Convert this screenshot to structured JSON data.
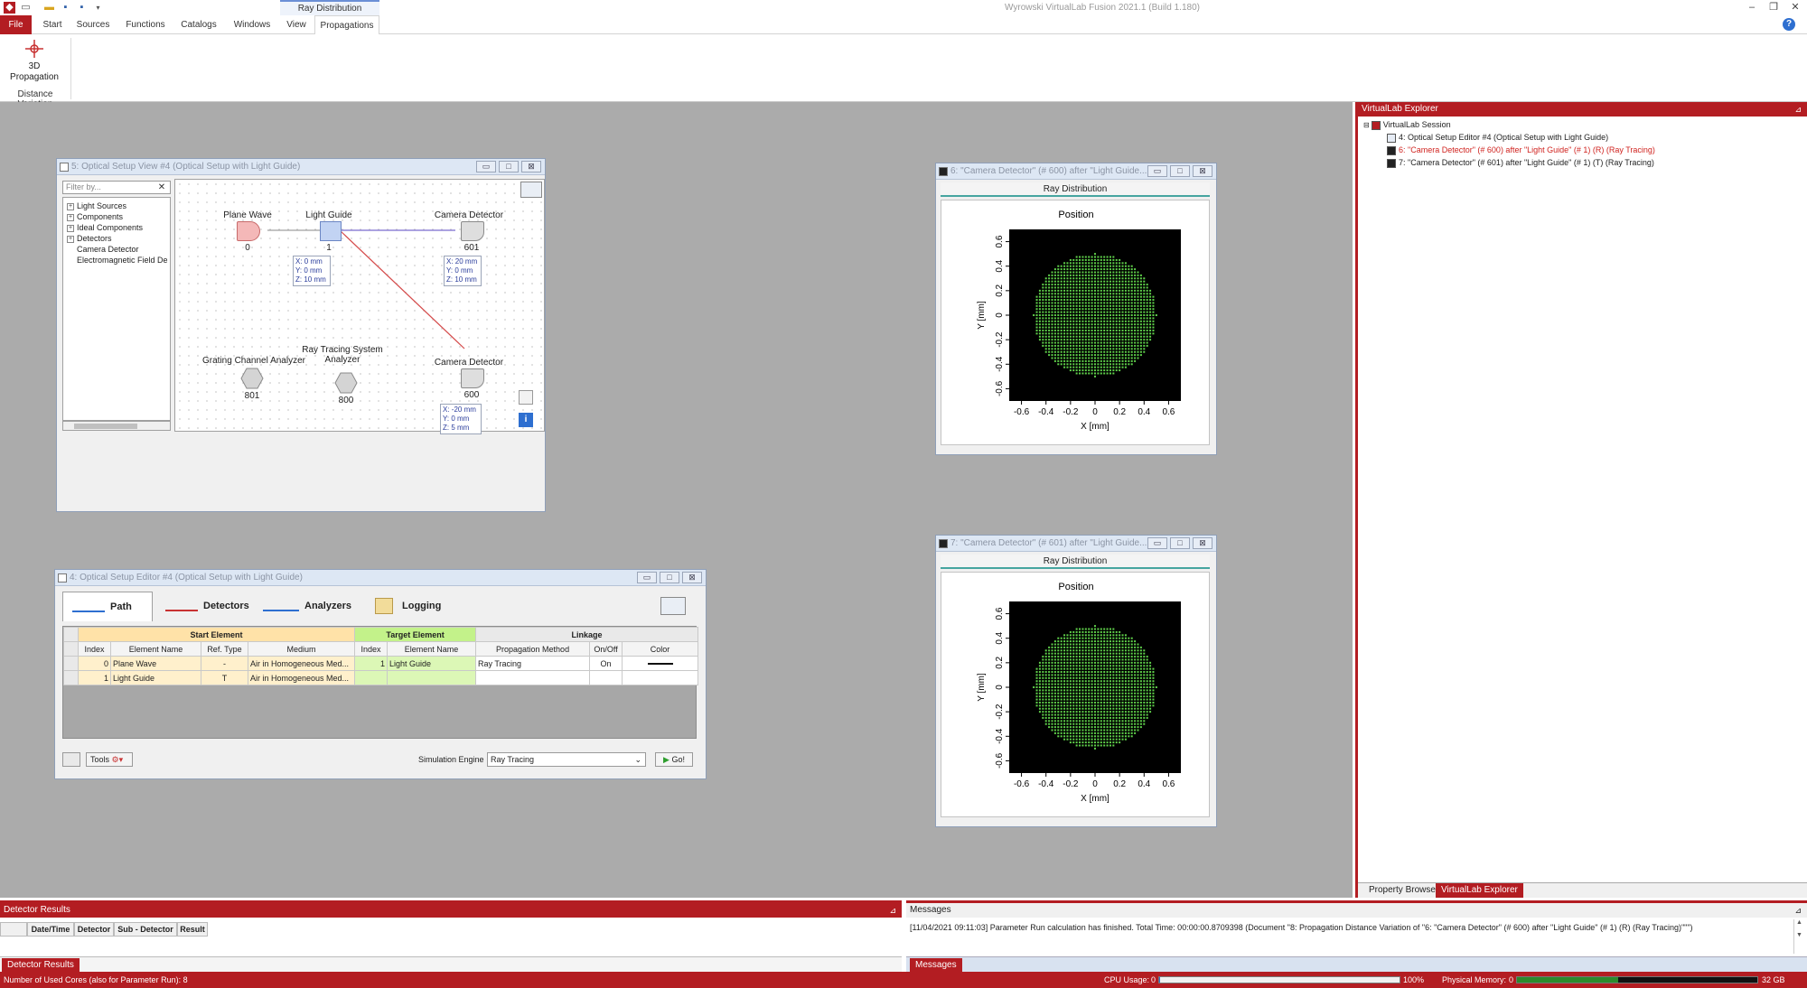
{
  "app": {
    "title": "Wyrowski VirtualLab Fusion 2021.1 (Build 1.180)",
    "context_tab": "Ray Distribution",
    "help_label": "?"
  },
  "ribbon": {
    "tabs": [
      "File",
      "Start",
      "Sources",
      "Functions",
      "Catalogs",
      "Windows",
      "View",
      "Propagations"
    ],
    "active_tab": "Propagations",
    "buttons": [
      {
        "label_line1": "3D",
        "label_line2": "Propagation"
      }
    ],
    "group_label": "Distance Variation"
  },
  "setup_view": {
    "title": "5: Optical Setup View #4 (Optical Setup with Light Guide)",
    "filter_placeholder": "Filter by...",
    "tree": [
      {
        "label": "Light Sources",
        "expandable": true
      },
      {
        "label": "Components",
        "expandable": true
      },
      {
        "label": "Ideal Components",
        "expandable": true
      },
      {
        "label": "Detectors",
        "expandable": true
      },
      {
        "label": "Camera Detector",
        "expandable": false
      },
      {
        "label": "Electromagnetic Field De",
        "expandable": false
      }
    ],
    "nodes": {
      "plane_wave": {
        "label": "Plane Wave",
        "index": "0"
      },
      "light_guide": {
        "label": "Light Guide",
        "index": "1",
        "coords": [
          "X: 0 mm",
          "Y: 0 mm",
          "Z: 10 mm"
        ]
      },
      "camera_601": {
        "label": "Camera Detector",
        "index": "601",
        "coords": [
          "X: 20 mm",
          "Y: 0 mm",
          "Z: 10 mm"
        ]
      },
      "grating": {
        "label": "Grating Channel Analyzer",
        "index": "801"
      },
      "ray_tracing": {
        "label_line1": "Ray Tracing System",
        "label_line2": "Analyzer",
        "index": "800"
      },
      "camera_600": {
        "label": "Camera Detector",
        "index": "600",
        "coords": [
          "X: -20 mm",
          "Y: 0 mm",
          "Z: 5 mm"
        ]
      }
    }
  },
  "editor": {
    "title": "4: Optical Setup Editor #4 (Optical Setup with Light Guide)",
    "tabs": [
      "Path",
      "Detectors",
      "Analyzers",
      "Logging"
    ],
    "active_tab": "Path",
    "group_headers": {
      "start": "Start Element",
      "target": "Target Element",
      "linkage": "Linkage"
    },
    "columns": [
      "Index",
      "Element Name",
      "Ref. Type",
      "Medium",
      "Index",
      "Element Name",
      "Propagation Method",
      "On/Off",
      "Color"
    ],
    "rows": [
      [
        "0",
        "Plane Wave",
        "-",
        "Air in Homogeneous Med...",
        "1",
        "Light Guide",
        "Ray Tracing",
        "On",
        "line"
      ],
      [
        "1",
        "Light Guide",
        "T",
        "Air in Homogeneous Med...",
        "",
        "",
        "",
        "",
        ""
      ]
    ],
    "tools_label": "Tools",
    "sim_engine_label": "Simulation Engine",
    "sim_engine_value": "Ray Tracing",
    "go_label": "Go!"
  },
  "ray_windows": [
    {
      "title": "6: \"Camera Detector\" (# 600) after \"Light Guide\" (# 1) (R) (Ray Tracing)",
      "title_visible": "6: \"Camera Detector\" (# 600) after \"Light Guide...",
      "tab": "Ray Distribution",
      "plot_title": "Position",
      "xlabel": "X [mm]",
      "ylabel": "Y [mm]"
    },
    {
      "title": "7: \"Camera Detector\" (# 601) after \"Light Guide\" (# 1) (T) (Ray Tracing)",
      "title_visible": "7: \"Camera Detector\" (# 601) after \"Light Guide...",
      "tab": "Ray Distribution",
      "plot_title": "Position",
      "xlabel": "X [mm]",
      "ylabel": "Y [mm]"
    }
  ],
  "plot_axis": {
    "ticks": [
      "-0.6",
      "-0.4",
      "-0.2",
      "0",
      "0.2",
      "0.4",
      "0.6"
    ],
    "range": [
      -0.7,
      0.7
    ],
    "spot_radius": 0.5,
    "grid_step": 0.025,
    "background_color": "#000000",
    "point_color": "#5fd04a"
  },
  "explorer": {
    "header": "VirtualLab Explorer",
    "items": [
      {
        "label": "VirtualLab Session",
        "level": 0,
        "highlight": false
      },
      {
        "label": "4: Optical Setup Editor #4 (Optical Setup with Light Guide)",
        "level": 1,
        "highlight": false
      },
      {
        "label": "6: \"Camera Detector\" (# 600) after \"Light Guide\" (# 1) (R) (Ray Tracing)",
        "level": 1,
        "highlight": true
      },
      {
        "label": "7: \"Camera Detector\" (# 601) after \"Light Guide\" (# 1) (T) (Ray Tracing)",
        "level": 1,
        "highlight": false
      }
    ],
    "bottom_tabs": [
      "Property Browser",
      "VirtualLab Explorer"
    ],
    "active_bottom_tab": "VirtualLab Explorer"
  },
  "detector_results": {
    "header": "Detector Results",
    "columns": [
      "Date/Time",
      "Detector",
      "Sub - Detector",
      "Result"
    ],
    "tab": "Detector Results"
  },
  "messages": {
    "header": "Messages",
    "text": "[11/04/2021 09:11:03] Parameter Run calculation has finished. Total Time: 00:00:00.8709398 (Document \"8: Propagation Distance Variation of \"6: \"Camera Detector\" (# 600) after \"Light Guide\" (# 1) (R) (Ray Tracing)\"\"\")",
    "tab": "Messages"
  },
  "status": {
    "cores": "Number of Used Cores (also for Parameter Run): 8",
    "cpu_label": "CPU Usage:",
    "cpu_min": "0",
    "cpu_value": "0.003",
    "cpu_max": "100%",
    "mem_label": "Physical Memory:",
    "mem_min": "0",
    "mem_value": "0.42",
    "mem_max": "32 GB"
  },
  "colors": {
    "accent": "#b31d22",
    "workspace": "#ababab",
    "path_line": "#7a6ccf",
    "reflection_line": "#d54c4c"
  }
}
